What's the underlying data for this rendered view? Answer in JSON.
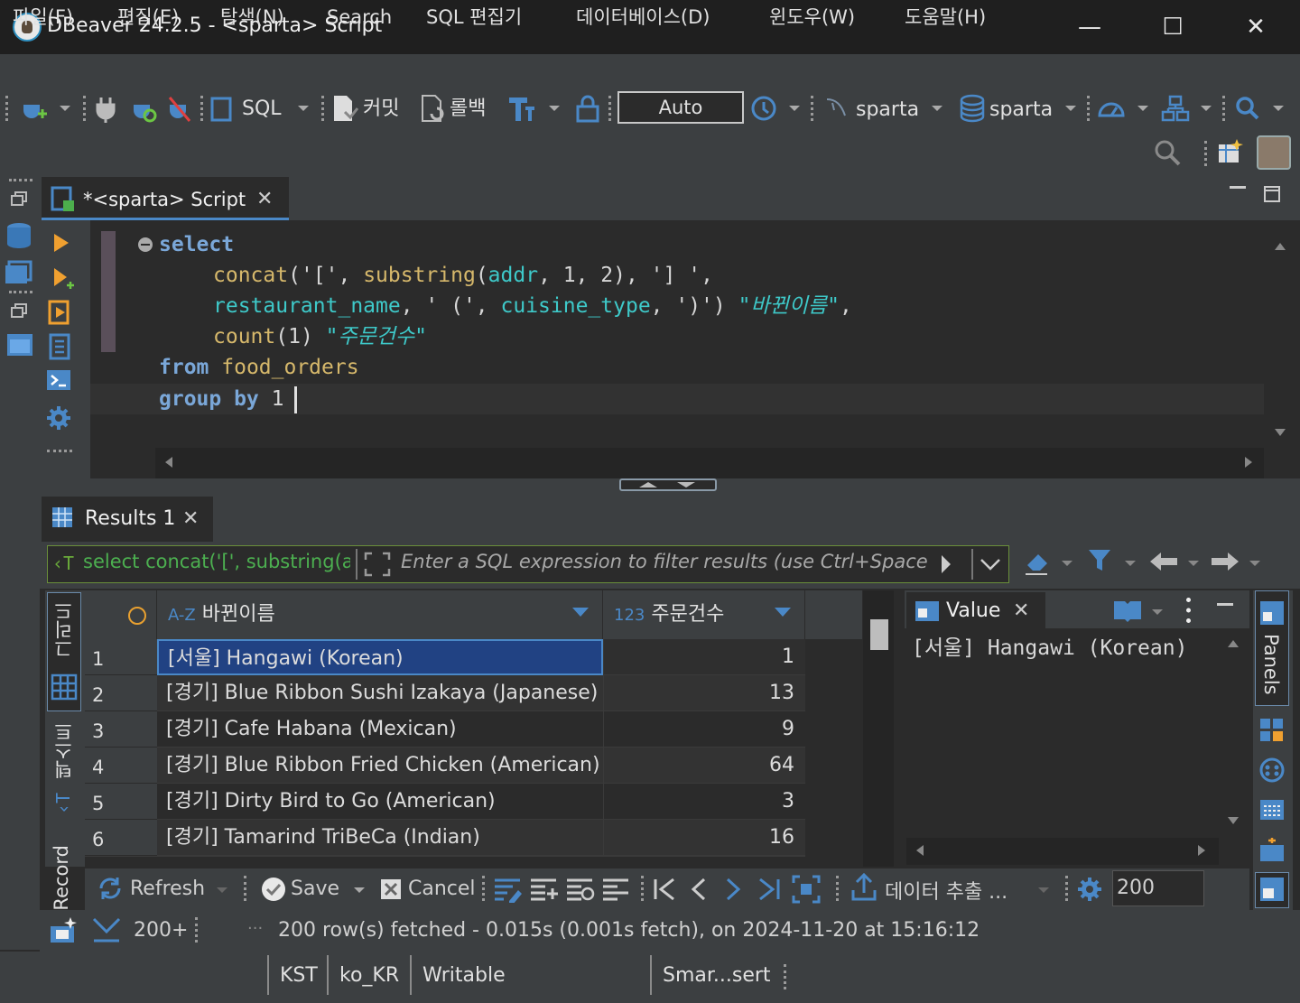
{
  "window": {
    "title": "DBeaver 24.2.5 - <sparta> Script",
    "minimize": "—",
    "maximize": "☐",
    "close": "✕"
  },
  "menu": [
    "파일(F)",
    "편집(E)",
    "탐색(N)",
    "Search",
    "SQL 편집기",
    "데이터베이스(D)",
    "윈도우(W)",
    "도움말(H)"
  ],
  "toolbar": {
    "sql_label": "SQL",
    "commit_label": "커밋",
    "rollback_label": "롤백",
    "transaction_mode": "Auto",
    "datasource": "sparta",
    "schema": "sparta"
  },
  "editor_tab": {
    "label": "*<sparta> Script",
    "close": "✕"
  },
  "sql": {
    "l1_kw": "select",
    "l2": {
      "fn1": "concat",
      "p1": "('[', ",
      "fn2": "substring",
      "p2": "(",
      "col1": "addr",
      "p3": ", 1, 2), '] ',"
    },
    "l3": {
      "col1": "restaurant_name",
      "p1": ", ' (', ",
      "col2": "cuisine_type",
      "p2": ", ')') ",
      "alias": "\"바뀐이름\"",
      "p3": ","
    },
    "l4": {
      "fn": "count",
      "p1": "(1) ",
      "alias": "\"주문건수\""
    },
    "l5": {
      "kw": "from",
      "table": "food_orders"
    },
    "l6": {
      "kw": "group by",
      "num": "1"
    }
  },
  "results": {
    "tab_label": "Results 1",
    "tab_close": "✕",
    "query_preview": "select concat('[', substring(a",
    "filter_placeholder": "Enter a SQL expression to filter results (use Ctrl+Space",
    "columns": [
      {
        "type": "A-Z",
        "name": "바뀐이름"
      },
      {
        "type": "123",
        "name": "주문건수"
      }
    ],
    "rows": [
      {
        "num": "1",
        "name": "[서울] Hangawi (Korean)",
        "count": "1"
      },
      {
        "num": "2",
        "name": "[경기] Blue Ribbon Sushi Izakaya (Japanese)",
        "count": "13"
      },
      {
        "num": "3",
        "name": "[경기] Cafe Habana (Mexican)",
        "count": "9"
      },
      {
        "num": "4",
        "name": "[경기] Blue Ribbon Fried Chicken (American)",
        "count": "64"
      },
      {
        "num": "5",
        "name": "[경기] Dirty Bird to Go (American)",
        "count": "3"
      },
      {
        "num": "6",
        "name": "[경기] Tamarind TriBeCa (Indian)",
        "count": "16"
      }
    ],
    "side_tabs": {
      "grid": "그리드",
      "text": "텍스트",
      "record": "Record"
    }
  },
  "value_panel": {
    "tab_label": "Value",
    "tab_close": "✕",
    "content": "[서울] Hangawi (Korean)"
  },
  "panels_label": "Panels",
  "bottom_toolbar": {
    "refresh": "Refresh",
    "save": "Save",
    "cancel": "Cancel",
    "export": "데이터 추출 ...",
    "fetch_size": "200"
  },
  "status": {
    "row_count": "200+",
    "message": "200 row(s) fetched - 0.015s (0.001s fetch), on 2024-11-20 at 15:16:12"
  },
  "statusbar": {
    "timezone": "KST",
    "locale": "ko_KR",
    "mode": "Writable",
    "insert": "Smar...sert"
  },
  "colors": {
    "accent": "#4a88c7",
    "selection": "#214283",
    "background": "#2b2b2b",
    "panel": "#3c3f41"
  }
}
